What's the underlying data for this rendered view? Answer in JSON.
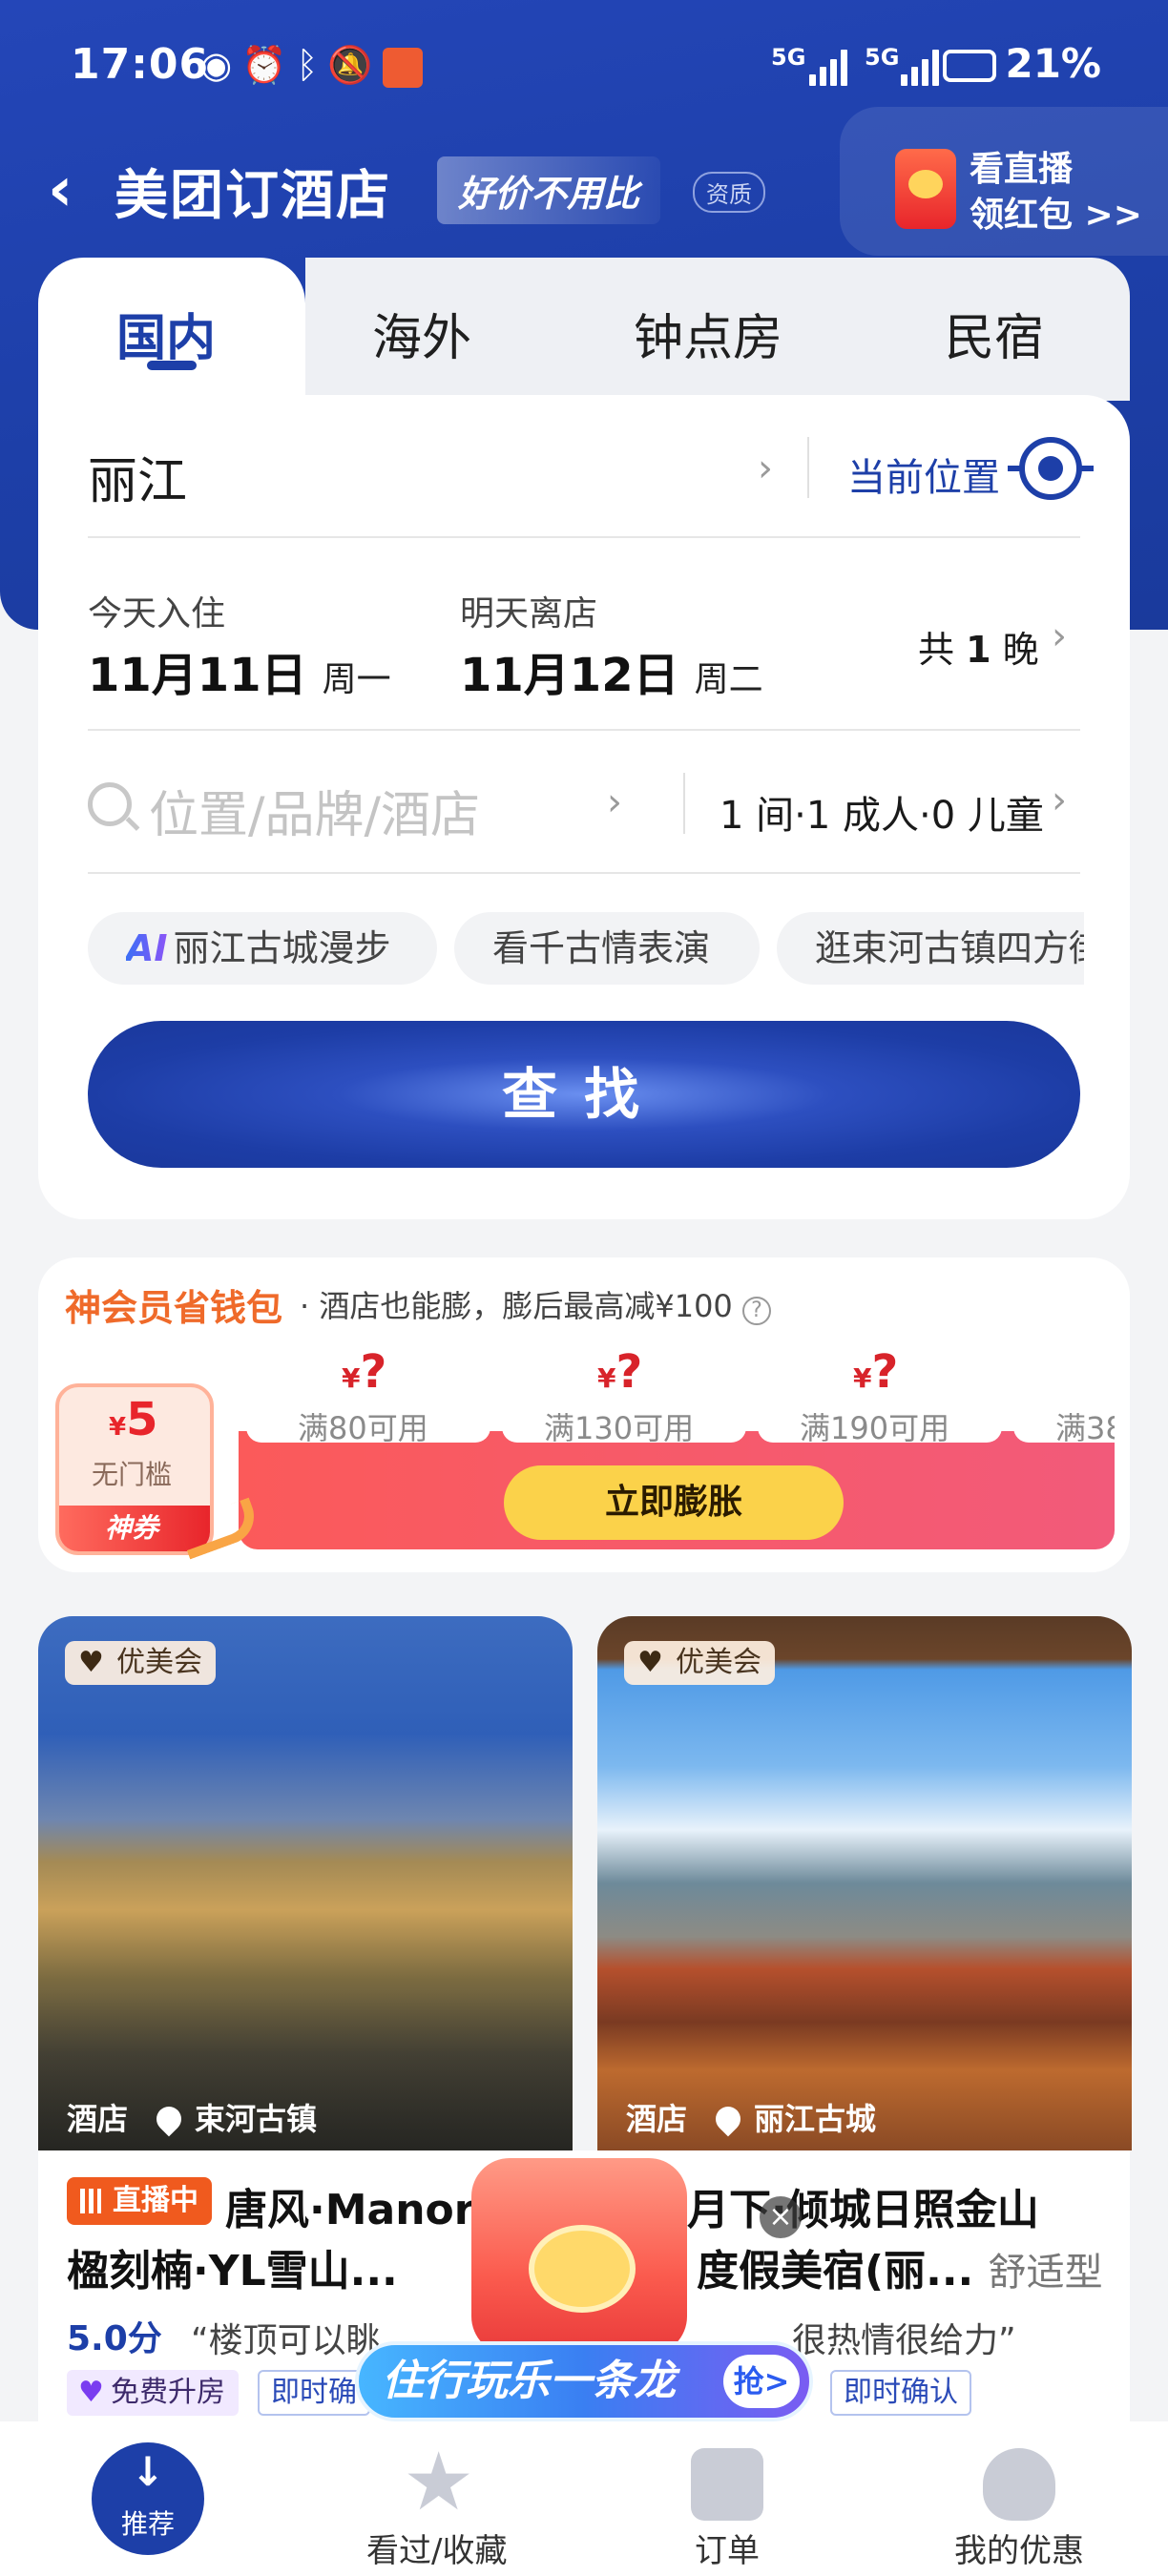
{
  "status_bar": {
    "time": "17:06",
    "icons": [
      "eye-icon",
      "alarm-icon",
      "bluetooth-icon",
      "mute-icon",
      "app-icon"
    ],
    "network1": "5G",
    "network2": "5G",
    "battery": "21%"
  },
  "nav": {
    "title": "美团订酒店",
    "tag": "好价不用比",
    "qualification": "资质",
    "live_promo_line1": "看直播",
    "live_promo_line2": "领红包 >>"
  },
  "tabs": [
    "国内",
    "海外",
    "钟点房",
    "民宿"
  ],
  "search": {
    "city": "丽江",
    "current_location": "当前位置",
    "checkin_label": "今天入住",
    "checkin_date": "11月11日",
    "checkin_weekday": "周一",
    "checkout_label": "明天离店",
    "checkout_date": "11月12日",
    "checkout_weekday": "周二",
    "nights_prefix": "共",
    "nights_count": "1",
    "nights_suffix": "晚",
    "keyword_placeholder": "位置/品牌/酒店",
    "guests": "1 间·1 成人·0 儿童",
    "chips": [
      {
        "badge": "AI",
        "label": "丽江古城漫步"
      },
      {
        "label": "看千古情表演"
      },
      {
        "label": "逛束河古镇四方街"
      }
    ],
    "find_button": "查找"
  },
  "wallet": {
    "title": "神会员省钱包",
    "subtitle": "· 酒店也能膨，膨后最高减¥100",
    "big_coupon_amount": "5",
    "big_coupon_currency": "¥",
    "big_coupon_label": "无门槛",
    "big_coupon_footer": "神券",
    "coupons": [
      {
        "amount": "?",
        "label": "满80可用"
      },
      {
        "amount": "?",
        "label": "满130可用"
      },
      {
        "amount": "?",
        "label": "满190可用"
      },
      {
        "amount": "?",
        "label": "满38"
      }
    ],
    "expand_button": "立即膨胀"
  },
  "hotels": [
    {
      "badge": "优美会",
      "category": "酒店",
      "location": "束河古镇",
      "live_tag": "直播中",
      "name_line1": "唐风·Manor",
      "name_line2": "楹刻楠·YL雪山...",
      "score": "5.0分",
      "review": "“楼顶可以眺",
      "tags": [
        "免费升房",
        "即时确"
      ]
    },
    {
      "badge": "优美会",
      "category": "酒店",
      "location": "丽江古城",
      "name_line1": "宿月下·倾城日照金山",
      "name_line2": "度假美宿(丽...",
      "type": "舒适型",
      "review": "很热情很给力”",
      "tags": [
        "即时确认"
      ]
    }
  ],
  "promo": {
    "banner": "住行玩乐一条龙",
    "grab": "抢>",
    "close": "×"
  },
  "bottom_nav": [
    {
      "label": "推荐",
      "icon": "arrow-down-icon"
    },
    {
      "label": "看过/收藏",
      "icon": "star-icon"
    },
    {
      "label": "订单",
      "icon": "order-icon"
    },
    {
      "label": "我的优惠",
      "icon": "coupon-icon"
    }
  ],
  "colors": {
    "brand_blue": "#1d3fa8",
    "wallet_orange": "#ef6a2a",
    "coupon_red": "#d8232a",
    "expand_yellow": "#fbd24a"
  }
}
